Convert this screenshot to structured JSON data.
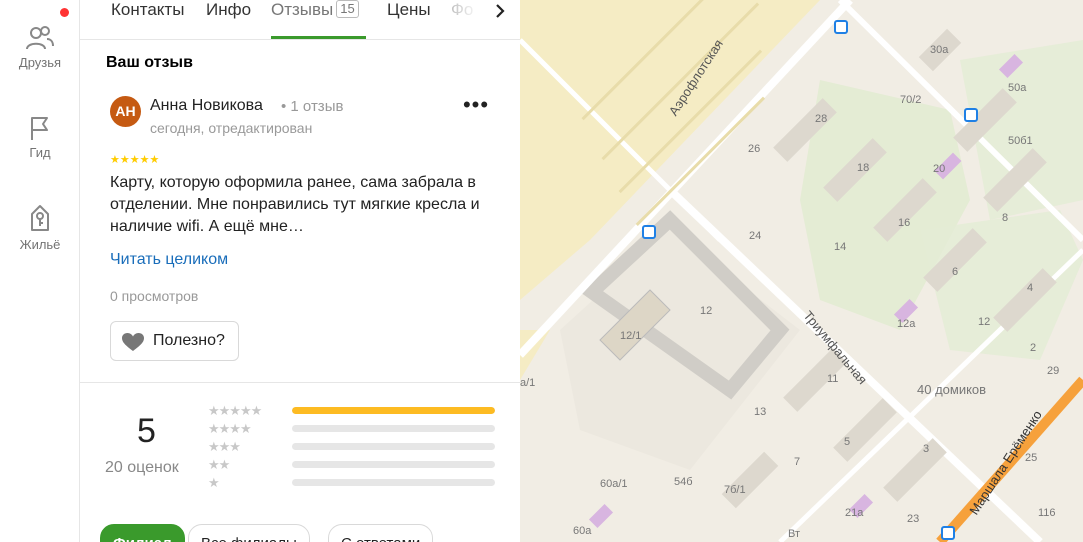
{
  "nav": {
    "items": [
      {
        "label": "Друзья",
        "icon": "friends-icon"
      },
      {
        "label": "Гид",
        "icon": "flag-icon"
      },
      {
        "label": "Жильё",
        "icon": "house-icon"
      }
    ],
    "notification_color": "#ff3333"
  },
  "tabs": {
    "items": [
      {
        "label": "Контакты"
      },
      {
        "label": "Инфо"
      },
      {
        "label": "Отзывы",
        "count": "15",
        "active": true
      },
      {
        "label": "Цены"
      },
      {
        "label": "Фо"
      }
    ],
    "next_icon": "chevron-right-icon"
  },
  "review": {
    "section_title": "Ваш отзыв",
    "avatar_initials": "АН",
    "author": "Анна Новикова",
    "author_meta": "• 1 отзыв",
    "sub_meta": "сегодня, отредактирован",
    "more_icon": "•••",
    "stars": "★★★★★",
    "rating": 5,
    "text": "Карту, которую оформила ранее, сама забрала в отделении. Мне понравились тут мягкие кресла и наличие wifi. А ещё мне…",
    "read_more": "Читать целиком",
    "views": "0 просмотров",
    "useful_label": "Полезно?"
  },
  "rating_summary": {
    "score": "5",
    "count_label": "20 оценок",
    "distribution": [
      {
        "stars": "★★★★★",
        "fraction": 1.0
      },
      {
        "stars": "★★★★",
        "fraction": 0.0
      },
      {
        "stars": "★★★",
        "fraction": 0.0
      },
      {
        "stars": "★★",
        "fraction": 0.0
      },
      {
        "stars": "★",
        "fraction": 0.0
      }
    ],
    "bar_color": "#fdbb22"
  },
  "filters": [
    {
      "label": "Филиал",
      "active": true
    },
    {
      "label": "Все филиалы"
    },
    {
      "label": "С ответами"
    }
  ],
  "map": {
    "streets": [
      "Аэрофлотская",
      "Триумфальная",
      "Маршала Ерёменко"
    ],
    "labels": [
      "30а",
      "70/2",
      "50а",
      "28",
      "50б1",
      "26",
      "18",
      "20",
      "16",
      "8",
      "24",
      "14",
      "6",
      "4",
      "12/1",
      "12",
      "12а",
      "12",
      "2",
      "11",
      "40 домиков",
      "29",
      "13",
      "5",
      "3",
      "7",
      "25",
      "60а/1",
      "54б",
      "7б/1",
      "21а",
      "60а",
      "23",
      "116",
      "а/1",
      "Вт"
    ]
  }
}
